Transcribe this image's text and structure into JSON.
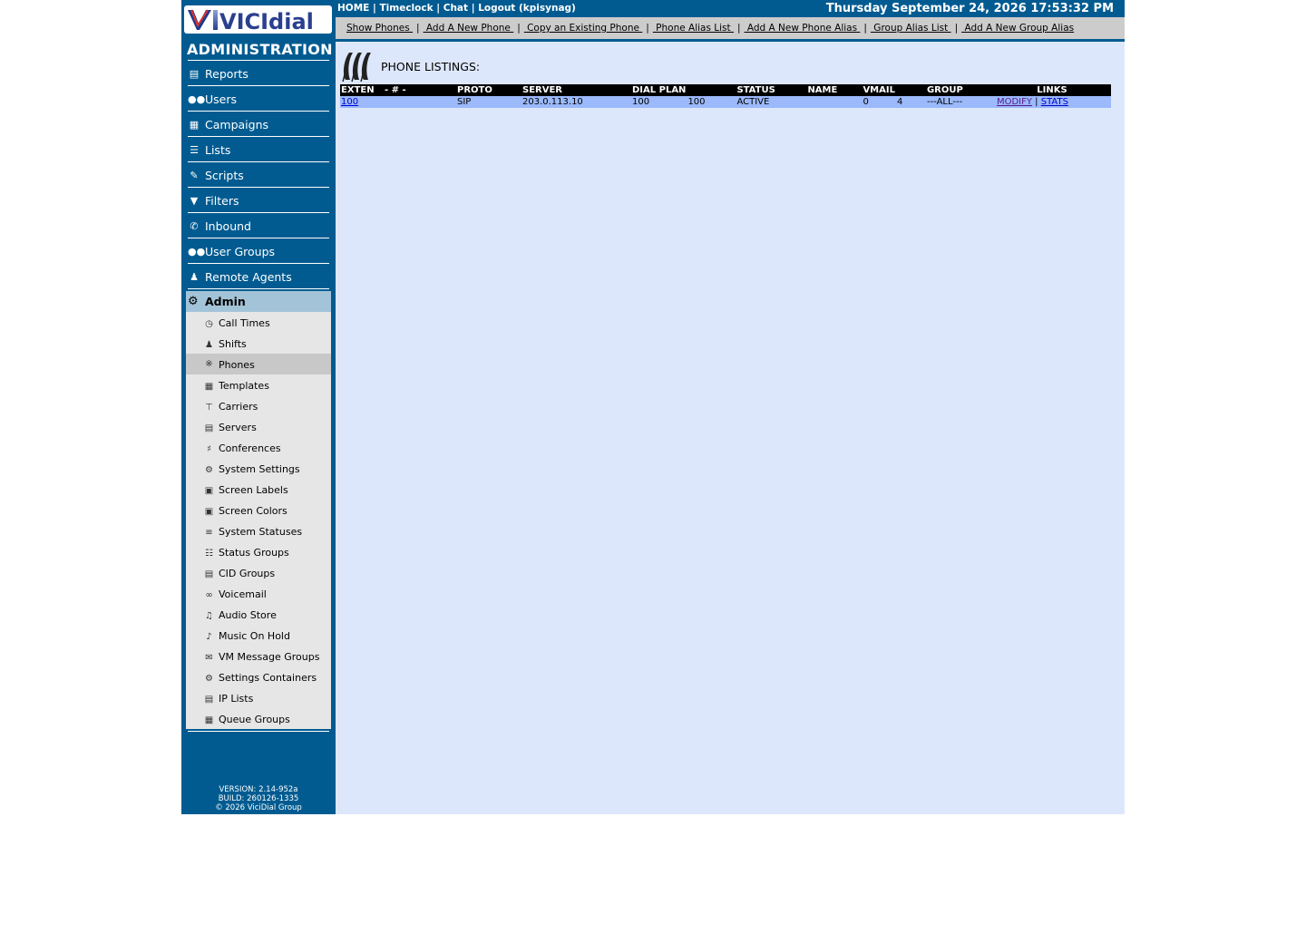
{
  "sidebar": {
    "logo_text": "VICIdial",
    "title": "ADMINISTRATION",
    "menu": [
      {
        "label": "Reports",
        "icon": "reports-icon"
      },
      {
        "label": "Users",
        "icon": "users-icon"
      },
      {
        "label": "Campaigns",
        "icon": "campaigns-icon"
      },
      {
        "label": "Lists",
        "icon": "lists-icon"
      },
      {
        "label": "Scripts",
        "icon": "scripts-icon"
      },
      {
        "label": "Filters",
        "icon": "filter-icon"
      },
      {
        "label": "Inbound",
        "icon": "inbound-icon"
      },
      {
        "label": "User Groups",
        "icon": "user-groups-icon"
      },
      {
        "label": "Remote Agents",
        "icon": "remote-agents-icon"
      }
    ],
    "active_section": "Admin",
    "submenu": [
      {
        "label": "Call Times",
        "icon": "clock-icon"
      },
      {
        "label": "Shifts",
        "icon": "shifts-icon"
      },
      {
        "label": "Phones",
        "icon": "phones-icon",
        "selected": true
      },
      {
        "label": "Templates",
        "icon": "templates-icon"
      },
      {
        "label": "Carriers",
        "icon": "carriers-icon"
      },
      {
        "label": "Servers",
        "icon": "servers-icon"
      },
      {
        "label": "Conferences",
        "icon": "conferences-icon"
      },
      {
        "label": "System Settings",
        "icon": "system-settings-icon"
      },
      {
        "label": "Screen Labels",
        "icon": "screen-labels-icon"
      },
      {
        "label": "Screen Colors",
        "icon": "screen-colors-icon"
      },
      {
        "label": "System Statuses",
        "icon": "system-statuses-icon"
      },
      {
        "label": "Status Groups",
        "icon": "status-groups-icon"
      },
      {
        "label": "CID Groups",
        "icon": "cid-groups-icon"
      },
      {
        "label": "Voicemail",
        "icon": "voicemail-icon"
      },
      {
        "label": "Audio Store",
        "icon": "audio-store-icon"
      },
      {
        "label": "Music On Hold",
        "icon": "music-on-hold-icon"
      },
      {
        "label": "VM Message Groups",
        "icon": "vm-message-groups-icon"
      },
      {
        "label": "Settings Containers",
        "icon": "settings-containers-icon"
      },
      {
        "label": "IP Lists",
        "icon": "ip-lists-icon"
      },
      {
        "label": "Queue Groups",
        "icon": "queue-groups-icon"
      }
    ],
    "version": "VERSION: 2.14-952a",
    "build": "BUILD: 260126-1335",
    "copyright": "© 2026 ViciDial Group"
  },
  "header": {
    "home": "HOME",
    "timeclock": "Timeclock",
    "chat": "Chat",
    "logout": "Logout (kpisynag)",
    "datetime": "Thursday September 24, 2026 17:53:32 PM"
  },
  "subnav": {
    "show_phones": " Show Phones ",
    "add_phone": " Add A New Phone ",
    "copy_phone": " Copy an Existing Phone ",
    "alias_list": " Phone Alias List ",
    "add_alias": " Add A New Phone Alias ",
    "group_alias_list": " Group Alias List ",
    "add_group_alias": " Add A New Group Alias"
  },
  "main": {
    "title": "PHONE LISTINGS:",
    "columns": {
      "exten": "EXTEN",
      "num": "- # -",
      "proto": "PROTO",
      "server": "SERVER",
      "dialplan": "DIAL PLAN",
      "status": "STATUS",
      "name": "NAME",
      "vmail": "VMAIL",
      "group": "GROUP",
      "links": "LINKS"
    },
    "rows": [
      {
        "exten": "100",
        "num": "",
        "proto": "SIP",
        "server": "203.0.113.10",
        "dialplan": "100",
        "dialplan2": "100",
        "status": "ACTIVE",
        "name": "",
        "vmail_new": "0",
        "vmail_old": "4",
        "group": "---ALL---",
        "modify": "MODIFY",
        "stats": "STATS"
      }
    ]
  },
  "colors": {
    "sidebar_bg": "#015b91",
    "main_bg": "#dde7fb",
    "row_bg": "#9bb9fb",
    "subnav_bg": "#cccccc"
  }
}
